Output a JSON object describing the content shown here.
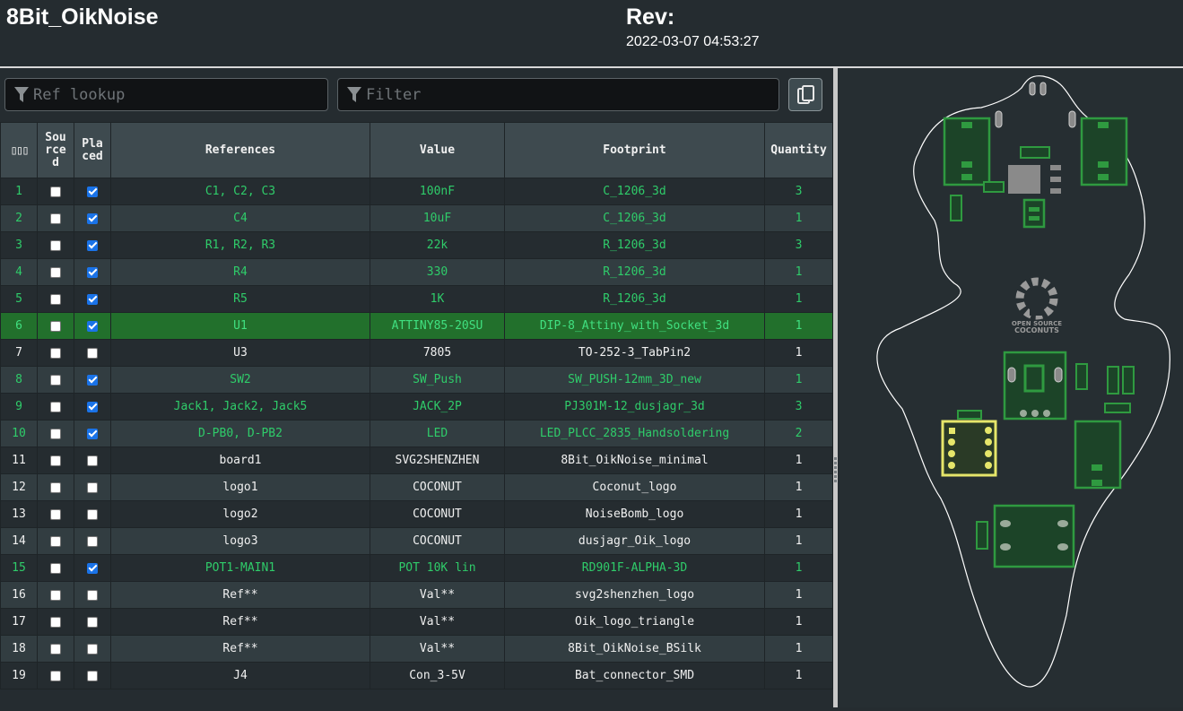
{
  "header": {
    "title": "8Bit_OikNoise",
    "rev_label": "Rev:",
    "date": "2022-03-07 04:53:27"
  },
  "controls": {
    "ref_lookup_placeholder": "Ref lookup",
    "filter_placeholder": "Filter",
    "filter_icon": "funnel-icon",
    "copy_icon": "copy-icon"
  },
  "table": {
    "columns": {
      "index": "▯▯▯",
      "sourced": "Sourced",
      "placed": "Placed",
      "references": "References",
      "value": "Value",
      "footprint": "Footprint",
      "quantity": "Quantity"
    },
    "rows": [
      {
        "n": "1",
        "sourced": false,
        "placed": true,
        "references": "C1, C2, C3",
        "value": "100nF",
        "footprint": "C_1206_3d",
        "quantity": "3"
      },
      {
        "n": "2",
        "sourced": false,
        "placed": true,
        "references": "C4",
        "value": "10uF",
        "footprint": "C_1206_3d",
        "quantity": "1"
      },
      {
        "n": "3",
        "sourced": false,
        "placed": true,
        "references": "R1, R2, R3",
        "value": "22k",
        "footprint": "R_1206_3d",
        "quantity": "3"
      },
      {
        "n": "4",
        "sourced": false,
        "placed": true,
        "references": "R4",
        "value": "330",
        "footprint": "R_1206_3d",
        "quantity": "1"
      },
      {
        "n": "5",
        "sourced": false,
        "placed": true,
        "references": "R5",
        "value": "1K",
        "footprint": "R_1206_3d",
        "quantity": "1"
      },
      {
        "n": "6",
        "sourced": false,
        "placed": true,
        "references": "U1",
        "value": "ATTINY85-20SU",
        "footprint": "DIP-8_Attiny_with_Socket_3d",
        "quantity": "1",
        "highlight": true
      },
      {
        "n": "7",
        "sourced": false,
        "placed": false,
        "references": "U3",
        "value": "7805",
        "footprint": "TO-252-3_TabPin2",
        "quantity": "1"
      },
      {
        "n": "8",
        "sourced": false,
        "placed": true,
        "references": "SW2",
        "value": "SW_Push",
        "footprint": "SW_PUSH-12mm_3D_new",
        "quantity": "1"
      },
      {
        "n": "9",
        "sourced": false,
        "placed": true,
        "references": "Jack1, Jack2, Jack5",
        "value": "JACK_2P",
        "footprint": "PJ301M-12_dusjagr_3d",
        "quantity": "3"
      },
      {
        "n": "10",
        "sourced": false,
        "placed": true,
        "references": "D-PB0, D-PB2",
        "value": "LED",
        "footprint": "LED_PLCC_2835_Handsoldering",
        "quantity": "2"
      },
      {
        "n": "11",
        "sourced": false,
        "placed": false,
        "references": "board1",
        "value": "SVG2SHENZHEN",
        "footprint": "8Bit_OikNoise_minimal",
        "quantity": "1"
      },
      {
        "n": "12",
        "sourced": false,
        "placed": false,
        "references": "logo1",
        "value": "COCONUT",
        "footprint": "Coconut_logo",
        "quantity": "1"
      },
      {
        "n": "13",
        "sourced": false,
        "placed": false,
        "references": "logo2",
        "value": "COCONUT",
        "footprint": "NoiseBomb_logo",
        "quantity": "1"
      },
      {
        "n": "14",
        "sourced": false,
        "placed": false,
        "references": "logo3",
        "value": "COCONUT",
        "footprint": "dusjagr_Oik_logo",
        "quantity": "1"
      },
      {
        "n": "15",
        "sourced": false,
        "placed": true,
        "references": "POT1-MAIN1",
        "value": "POT 10K lin",
        "footprint": "RD901F-ALPHA-3D",
        "quantity": "1"
      },
      {
        "n": "16",
        "sourced": false,
        "placed": false,
        "references": "Ref**",
        "value": "Val**",
        "footprint": "svg2shenzhen_logo",
        "quantity": "1"
      },
      {
        "n": "17",
        "sourced": false,
        "placed": false,
        "references": "Ref**",
        "value": "Val**",
        "footprint": "Oik_logo_triangle",
        "quantity": "1"
      },
      {
        "n": "18",
        "sourced": false,
        "placed": false,
        "references": "Ref**",
        "value": "Val**",
        "footprint": "8Bit_OikNoise_BSilk",
        "quantity": "1"
      },
      {
        "n": "19",
        "sourced": false,
        "placed": false,
        "references": "J4",
        "value": "Con_3-5V",
        "footprint": "Bat_connector_SMD",
        "quantity": "1"
      }
    ]
  },
  "pcb": {
    "logo_line1": "OPEN SOURCE",
    "logo_line2": "COCONUTS",
    "colors": {
      "board_bg": "#262e32",
      "outline": "#ffffff",
      "pad_green": "#2f9a40",
      "pad_fill": "#1c4428",
      "highlight": "#e6e66a",
      "ic_body": "#8a8a8a"
    }
  },
  "colors": {
    "placed_text": "#2fcc6a",
    "highlight_row": "#22702c",
    "header_bg": "#3e4a4f"
  }
}
